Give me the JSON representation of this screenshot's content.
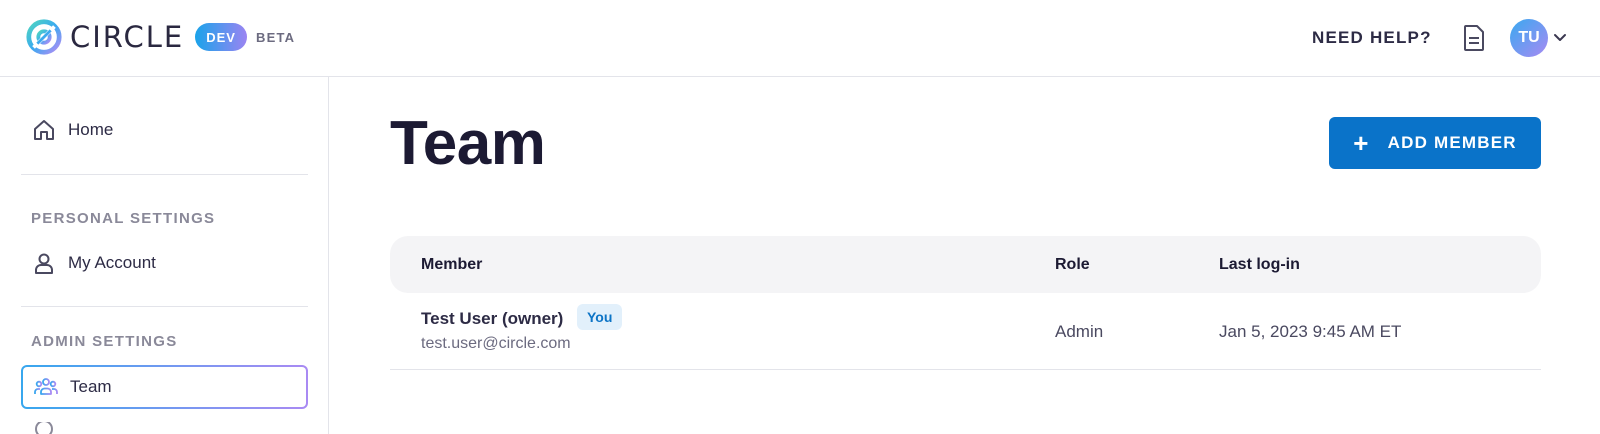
{
  "header": {
    "brand_name": "CIRCLE",
    "dev_badge": "DEV",
    "beta_label": "BETA",
    "help_label": "NEED HELP?",
    "avatar_initials": "TU",
    "icons": [
      "circle-logo-icon",
      "document-icon",
      "chevron-down-icon"
    ]
  },
  "sidebar": {
    "home_label": "Home",
    "personal_section": "PERSONAL SETTINGS",
    "account_label": "My Account",
    "admin_section": "ADMIN SETTINGS",
    "team_label": "Team",
    "active_item": "Team"
  },
  "main": {
    "title": "Team",
    "add_button_label": "ADD MEMBER",
    "table": {
      "columns": [
        "Member",
        "Role",
        "Last log-in"
      ],
      "rows": [
        {
          "name": "Test User (owner)",
          "badge": "You",
          "email": "test.user@circle.com",
          "role": "Admin",
          "last_login": "Jan 5, 2023 9:45 AM ET"
        }
      ]
    }
  },
  "colors": {
    "primary": "#0a73c9",
    "accent_gradient_start": "#37a7ee",
    "accent_gradient_end": "#a98af3",
    "text_dark": "#1c1a33"
  }
}
